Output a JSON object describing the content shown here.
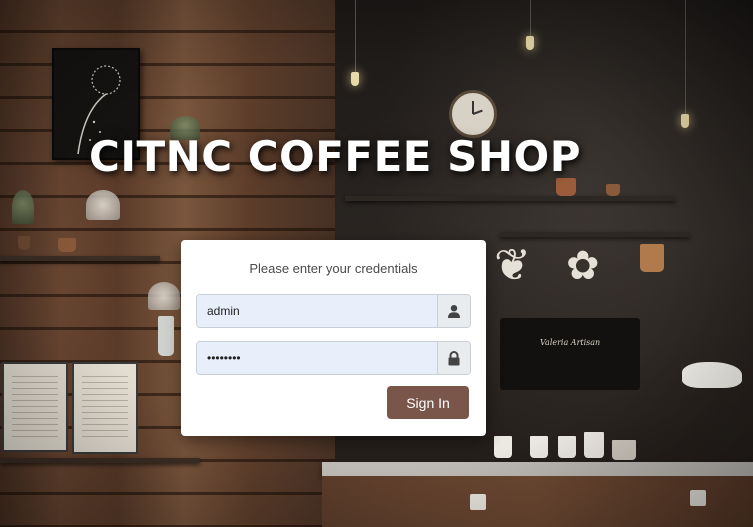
{
  "page": {
    "headline": "CITNC COFFEE SHOP"
  },
  "login": {
    "prompt": "Please enter your credentials",
    "username": {
      "value": "admin",
      "icon": "user-icon"
    },
    "password": {
      "value": "secret12",
      "icon": "lock-icon"
    },
    "sign_in_label": "Sign In"
  },
  "colors": {
    "button": "#7a564a",
    "input_background": "#e8effb",
    "headline": "#ffffff"
  },
  "background": {
    "machine_label": "Valeria Artisan"
  }
}
